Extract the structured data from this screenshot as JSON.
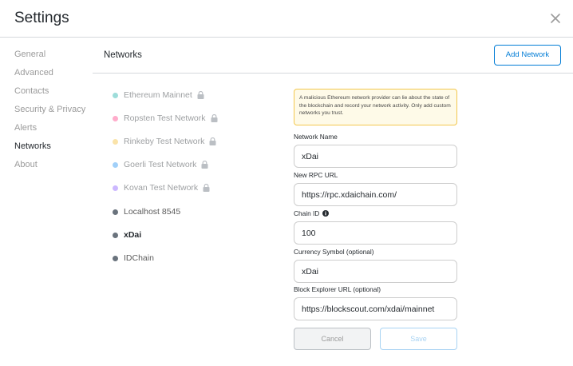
{
  "header": {
    "title": "Settings",
    "close_icon": "close-icon"
  },
  "sidebar": {
    "items": [
      {
        "label": "General"
      },
      {
        "label": "Advanced"
      },
      {
        "label": "Contacts"
      },
      {
        "label": "Security & Privacy"
      },
      {
        "label": "Alerts"
      },
      {
        "label": "Networks",
        "active": true
      },
      {
        "label": "About"
      }
    ]
  },
  "networks": {
    "title": "Networks",
    "add_button": "Add Network",
    "list": [
      {
        "label": "Ethereum Mainnet",
        "color": "#29b6af",
        "locked": true
      },
      {
        "label": "Ropsten Test Network",
        "color": "#ff4a8d",
        "locked": true
      },
      {
        "label": "Rinkeby Test Network",
        "color": "#f6c343",
        "locked": true
      },
      {
        "label": "Goerli Test Network",
        "color": "#3099f2",
        "locked": true
      },
      {
        "label": "Kovan Test Network",
        "color": "#9064ff",
        "locked": true
      },
      {
        "label": "Localhost 8545",
        "color": "#6a737d",
        "locked": false
      },
      {
        "label": "xDai",
        "color": "#6a737d",
        "locked": false,
        "selected": true
      },
      {
        "label": "IDChain",
        "color": "#6a737d",
        "locked": false
      }
    ]
  },
  "form": {
    "warning": "A malicious Ethereum network provider can lie about the state of the blockchain and record your network activity. Only add custom networks you trust.",
    "network_name_label": "Network Name",
    "network_name_value": "xDai",
    "rpc_url_label": "New RPC URL",
    "rpc_url_value": "https://rpc.xdaichain.com/",
    "chain_id_label": "Chain ID",
    "chain_id_value": "100",
    "symbol_label": "Currency Symbol (optional)",
    "symbol_value": "xDai",
    "explorer_label": "Block Explorer URL (optional)",
    "explorer_value": "https://blockscout.com/xdai/mainnet",
    "cancel_button": "Cancel",
    "save_button": "Save"
  },
  "colors": {
    "accent": "#037dd6",
    "warning_bg": "#fefae8",
    "warning_border": "#f3c84e"
  }
}
